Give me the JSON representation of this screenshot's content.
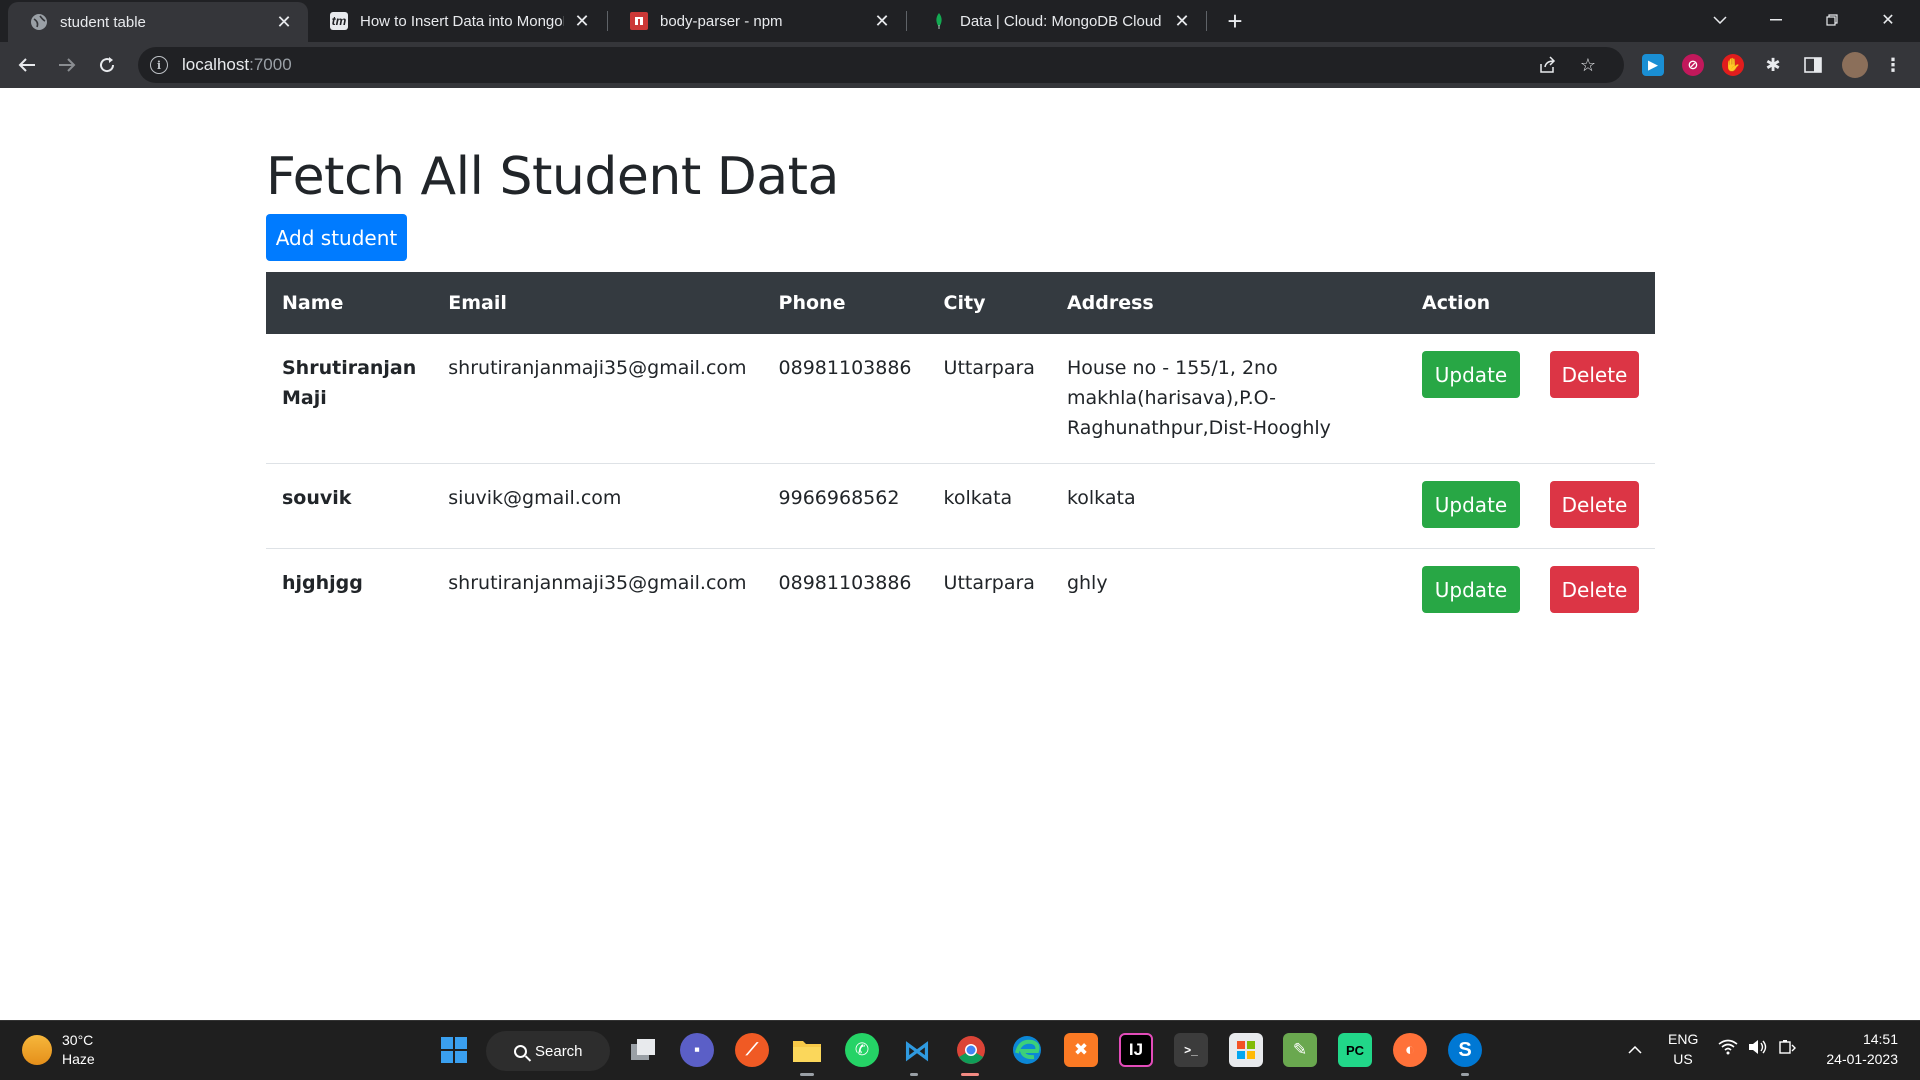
{
  "browser": {
    "tabs": [
      {
        "title": "student table",
        "active": true
      },
      {
        "title": "How to Insert Data into MongoD",
        "active": false
      },
      {
        "title": "body-parser - npm",
        "active": false
      },
      {
        "title": "Data | Cloud: MongoDB Cloud",
        "active": false
      }
    ],
    "url_host": "localhost",
    "url_port": ":7000"
  },
  "page": {
    "title": "Fetch All Student Data",
    "add_button": "Add student",
    "columns": [
      "Name",
      "Email",
      "Phone",
      "City",
      "Address",
      "Action"
    ],
    "rows": [
      {
        "name": "Shrutiranjan Maji",
        "email": "shrutiranjanmaji35@gmail.com",
        "phone": "08981103886",
        "city": "Uttarpara",
        "address": "House no - 155/1, 2no makhla(harisava),P.O-Raghunathpur,Dist-Hooghly",
        "update": "Update",
        "delete": "Delete"
      },
      {
        "name": "souvik",
        "email": "siuvik@gmail.com",
        "phone": "9966968562",
        "city": "kolkata",
        "address": "kolkata",
        "update": "Update",
        "delete": "Delete"
      },
      {
        "name": "hjghjgg",
        "email": "shrutiranjanmaji35@gmail.com",
        "phone": "08981103886",
        "city": "Uttarpara",
        "address": "ghly",
        "update": "Update",
        "delete": "Delete"
      }
    ],
    "colors": {
      "primary": "#007bff",
      "success": "#28a745",
      "danger": "#dc3545",
      "header_bg": "#343a40"
    }
  },
  "taskbar": {
    "weather_temp": "30°C",
    "weather_desc": "Haze",
    "search_label": "Search",
    "lang_top": "ENG",
    "lang_bottom": "US",
    "time": "14:51",
    "date": "24-01-2023"
  }
}
